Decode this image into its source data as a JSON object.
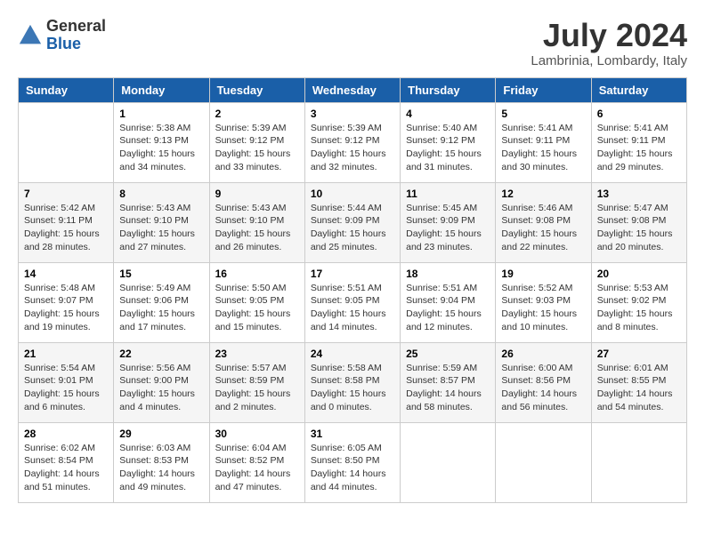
{
  "header": {
    "logo_general": "General",
    "logo_blue": "Blue",
    "month_title": "July 2024",
    "location": "Lambrinia, Lombardy, Italy"
  },
  "calendar": {
    "days_of_week": [
      "Sunday",
      "Monday",
      "Tuesday",
      "Wednesday",
      "Thursday",
      "Friday",
      "Saturday"
    ],
    "weeks": [
      [
        null,
        {
          "day": "1",
          "sunrise": "Sunrise: 5:38 AM",
          "sunset": "Sunset: 9:13 PM",
          "daylight": "Daylight: 15 hours and 34 minutes."
        },
        {
          "day": "2",
          "sunrise": "Sunrise: 5:39 AM",
          "sunset": "Sunset: 9:12 PM",
          "daylight": "Daylight: 15 hours and 33 minutes."
        },
        {
          "day": "3",
          "sunrise": "Sunrise: 5:39 AM",
          "sunset": "Sunset: 9:12 PM",
          "daylight": "Daylight: 15 hours and 32 minutes."
        },
        {
          "day": "4",
          "sunrise": "Sunrise: 5:40 AM",
          "sunset": "Sunset: 9:12 PM",
          "daylight": "Daylight: 15 hours and 31 minutes."
        },
        {
          "day": "5",
          "sunrise": "Sunrise: 5:41 AM",
          "sunset": "Sunset: 9:11 PM",
          "daylight": "Daylight: 15 hours and 30 minutes."
        },
        {
          "day": "6",
          "sunrise": "Sunrise: 5:41 AM",
          "sunset": "Sunset: 9:11 PM",
          "daylight": "Daylight: 15 hours and 29 minutes."
        }
      ],
      [
        {
          "day": "7",
          "sunrise": "Sunrise: 5:42 AM",
          "sunset": "Sunset: 9:11 PM",
          "daylight": "Daylight: 15 hours and 28 minutes."
        },
        {
          "day": "8",
          "sunrise": "Sunrise: 5:43 AM",
          "sunset": "Sunset: 9:10 PM",
          "daylight": "Daylight: 15 hours and 27 minutes."
        },
        {
          "day": "9",
          "sunrise": "Sunrise: 5:43 AM",
          "sunset": "Sunset: 9:10 PM",
          "daylight": "Daylight: 15 hours and 26 minutes."
        },
        {
          "day": "10",
          "sunrise": "Sunrise: 5:44 AM",
          "sunset": "Sunset: 9:09 PM",
          "daylight": "Daylight: 15 hours and 25 minutes."
        },
        {
          "day": "11",
          "sunrise": "Sunrise: 5:45 AM",
          "sunset": "Sunset: 9:09 PM",
          "daylight": "Daylight: 15 hours and 23 minutes."
        },
        {
          "day": "12",
          "sunrise": "Sunrise: 5:46 AM",
          "sunset": "Sunset: 9:08 PM",
          "daylight": "Daylight: 15 hours and 22 minutes."
        },
        {
          "day": "13",
          "sunrise": "Sunrise: 5:47 AM",
          "sunset": "Sunset: 9:08 PM",
          "daylight": "Daylight: 15 hours and 20 minutes."
        }
      ],
      [
        {
          "day": "14",
          "sunrise": "Sunrise: 5:48 AM",
          "sunset": "Sunset: 9:07 PM",
          "daylight": "Daylight: 15 hours and 19 minutes."
        },
        {
          "day": "15",
          "sunrise": "Sunrise: 5:49 AM",
          "sunset": "Sunset: 9:06 PM",
          "daylight": "Daylight: 15 hours and 17 minutes."
        },
        {
          "day": "16",
          "sunrise": "Sunrise: 5:50 AM",
          "sunset": "Sunset: 9:05 PM",
          "daylight": "Daylight: 15 hours and 15 minutes."
        },
        {
          "day": "17",
          "sunrise": "Sunrise: 5:51 AM",
          "sunset": "Sunset: 9:05 PM",
          "daylight": "Daylight: 15 hours and 14 minutes."
        },
        {
          "day": "18",
          "sunrise": "Sunrise: 5:51 AM",
          "sunset": "Sunset: 9:04 PM",
          "daylight": "Daylight: 15 hours and 12 minutes."
        },
        {
          "day": "19",
          "sunrise": "Sunrise: 5:52 AM",
          "sunset": "Sunset: 9:03 PM",
          "daylight": "Daylight: 15 hours and 10 minutes."
        },
        {
          "day": "20",
          "sunrise": "Sunrise: 5:53 AM",
          "sunset": "Sunset: 9:02 PM",
          "daylight": "Daylight: 15 hours and 8 minutes."
        }
      ],
      [
        {
          "day": "21",
          "sunrise": "Sunrise: 5:54 AM",
          "sunset": "Sunset: 9:01 PM",
          "daylight": "Daylight: 15 hours and 6 minutes."
        },
        {
          "day": "22",
          "sunrise": "Sunrise: 5:56 AM",
          "sunset": "Sunset: 9:00 PM",
          "daylight": "Daylight: 15 hours and 4 minutes."
        },
        {
          "day": "23",
          "sunrise": "Sunrise: 5:57 AM",
          "sunset": "Sunset: 8:59 PM",
          "daylight": "Daylight: 15 hours and 2 minutes."
        },
        {
          "day": "24",
          "sunrise": "Sunrise: 5:58 AM",
          "sunset": "Sunset: 8:58 PM",
          "daylight": "Daylight: 15 hours and 0 minutes."
        },
        {
          "day": "25",
          "sunrise": "Sunrise: 5:59 AM",
          "sunset": "Sunset: 8:57 PM",
          "daylight": "Daylight: 14 hours and 58 minutes."
        },
        {
          "day": "26",
          "sunrise": "Sunrise: 6:00 AM",
          "sunset": "Sunset: 8:56 PM",
          "daylight": "Daylight: 14 hours and 56 minutes."
        },
        {
          "day": "27",
          "sunrise": "Sunrise: 6:01 AM",
          "sunset": "Sunset: 8:55 PM",
          "daylight": "Daylight: 14 hours and 54 minutes."
        }
      ],
      [
        {
          "day": "28",
          "sunrise": "Sunrise: 6:02 AM",
          "sunset": "Sunset: 8:54 PM",
          "daylight": "Daylight: 14 hours and 51 minutes."
        },
        {
          "day": "29",
          "sunrise": "Sunrise: 6:03 AM",
          "sunset": "Sunset: 8:53 PM",
          "daylight": "Daylight: 14 hours and 49 minutes."
        },
        {
          "day": "30",
          "sunrise": "Sunrise: 6:04 AM",
          "sunset": "Sunset: 8:52 PM",
          "daylight": "Daylight: 14 hours and 47 minutes."
        },
        {
          "day": "31",
          "sunrise": "Sunrise: 6:05 AM",
          "sunset": "Sunset: 8:50 PM",
          "daylight": "Daylight: 14 hours and 44 minutes."
        },
        null,
        null,
        null
      ]
    ]
  }
}
